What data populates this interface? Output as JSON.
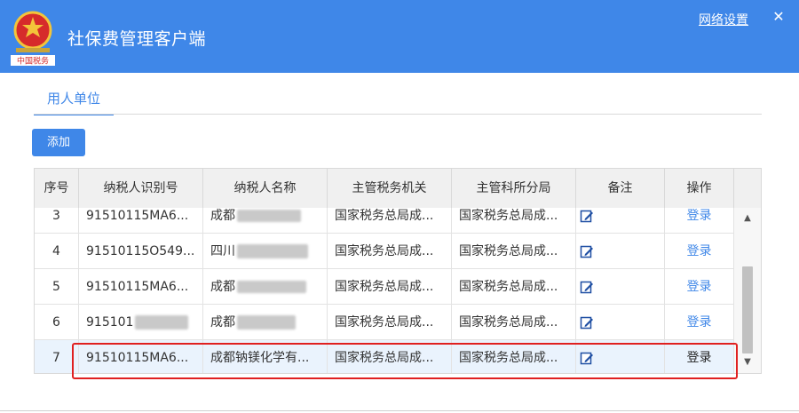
{
  "app": {
    "title": "社保费管理客户端",
    "network_settings_label": "网络设置",
    "close_symbol": "✕",
    "logo_text": "中国税务",
    "accent_color": "#3f87e8"
  },
  "tabs": [
    {
      "label": "用人单位",
      "active": true
    }
  ],
  "toolbar": {
    "add_label": "添加"
  },
  "table": {
    "headers": [
      "序号",
      "纳税人识别号",
      "纳税人名称",
      "主管税务机关",
      "主管科所分局",
      "备注",
      "操作"
    ],
    "rows": [
      {
        "index": "3",
        "tax_id": "91510115MA6...",
        "name": "成都",
        "authority": "国家税务总局成...",
        "branch": "国家税务总局成...",
        "action": "登录"
      },
      {
        "index": "4",
        "tax_id": "91510115O549...",
        "name": "四川",
        "authority": "国家税务总局成...",
        "branch": "国家税务总局成...",
        "action": "登录"
      },
      {
        "index": "5",
        "tax_id": "91510115MA6...",
        "name": "成都",
        "authority": "国家税务总局成...",
        "branch": "国家税务总局成...",
        "action": "登录"
      },
      {
        "index": "6",
        "tax_id": "915101",
        "name": "成都",
        "authority": "国家税务总局成...",
        "branch": "国家税务总局成...",
        "action": "登录"
      },
      {
        "index": "7",
        "tax_id": "91510115MA6...",
        "name": "成都钠镁化学有...",
        "authority": "国家税务总局成...",
        "branch": "国家税务总局成...",
        "action": "登录",
        "selected": true
      }
    ]
  },
  "icons": {
    "note": "edit-note-icon",
    "scroll_up": "▲",
    "scroll_down": "▼"
  },
  "colors": {
    "highlight_border": "#e02020",
    "selected_row": "#eaf3fd"
  }
}
